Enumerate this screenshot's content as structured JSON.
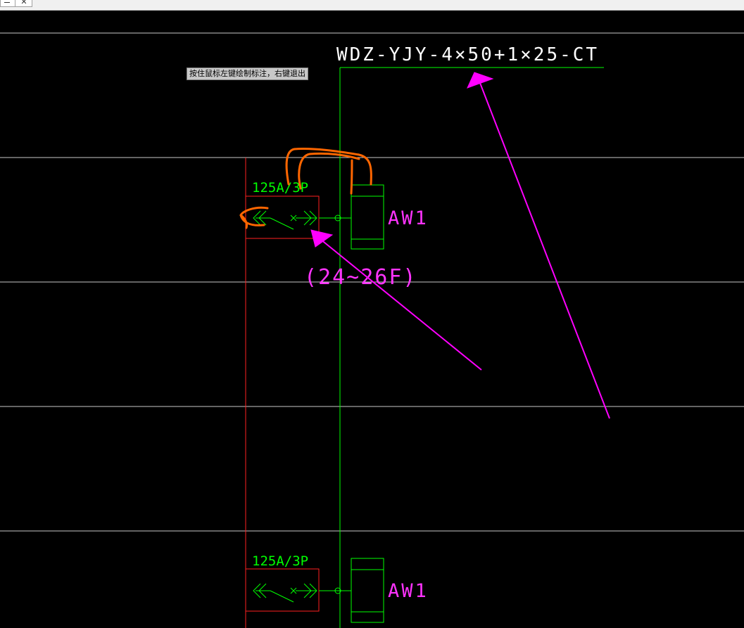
{
  "window": {
    "close_glyph": "✕"
  },
  "tooltip": "按住鼠标左键绘制标注，右键退出",
  "drawing": {
    "cable_spec": "WDZ-YJY-4×50+1×25-CT",
    "floor_range": "(24~26F)",
    "breakers": [
      {
        "rating": "125A/3P",
        "label": "AW1"
      },
      {
        "rating": "125A/3P",
        "label": "AW1"
      }
    ]
  },
  "colors": {
    "background": "#000000",
    "grid_line": "#c8c8c8",
    "wire": "#00ff00",
    "frame": "#ff2020",
    "label": "#ff33ff",
    "markup_arrow": "#ff00ff",
    "markup_scribble": "#ff6600",
    "text_white": "#ffffff"
  }
}
